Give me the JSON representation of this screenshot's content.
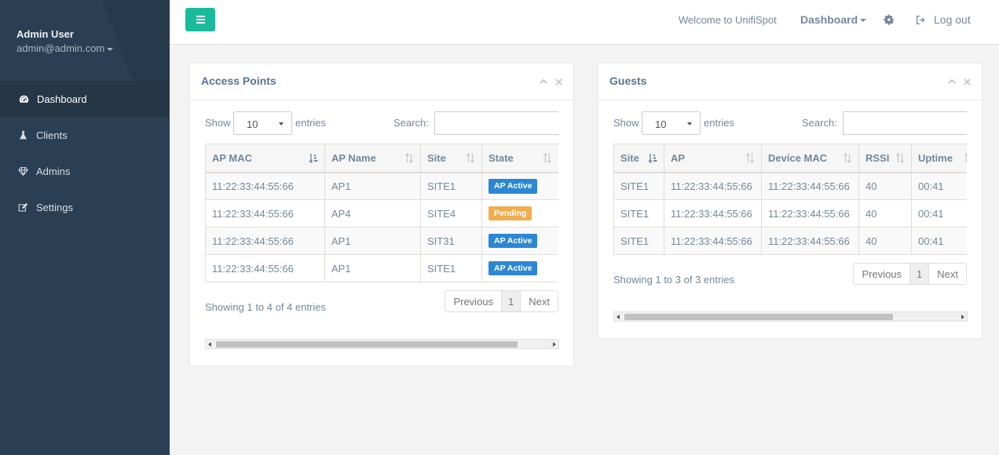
{
  "sidebar": {
    "user_name": "Admin User",
    "user_email": "admin@admin.com",
    "items": [
      {
        "label": "Dashboard",
        "icon": "dashboard-icon",
        "active": true
      },
      {
        "label": "Clients",
        "icon": "flask-icon",
        "active": false
      },
      {
        "label": "Admins",
        "icon": "diamond-icon",
        "active": false
      },
      {
        "label": "Settings",
        "icon": "edit-icon",
        "active": false
      }
    ]
  },
  "topbar": {
    "welcome": "Welcome to UnifiSpot",
    "dashboard_label": "Dashboard",
    "logout_label": "Log out"
  },
  "ap_panel": {
    "title": "Access Points",
    "show_label": "Show",
    "entries_label": "entries",
    "page_length": "10",
    "search_label": "Search:",
    "search_value": "",
    "columns": [
      "AP MAC",
      "AP Name",
      "Site",
      "State"
    ],
    "rows": [
      {
        "mac": "11:22:33:44:55:66",
        "name": "AP1",
        "site": "SITE1",
        "state": "AP Active",
        "state_type": "active"
      },
      {
        "mac": "11:22:33:44:55:66",
        "name": "AP4",
        "site": "SITE4",
        "state": "Pending",
        "state_type": "pending"
      },
      {
        "mac": "11:22:33:44:55:66",
        "name": "AP1",
        "site": "SIT31",
        "state": "AP Active",
        "state_type": "active"
      },
      {
        "mac": "11:22:33:44:55:66",
        "name": "AP1",
        "site": "SITE1",
        "state": "AP Active",
        "state_type": "active"
      }
    ],
    "info": "Showing 1 to 4 of 4 entries",
    "prev": "Previous",
    "page": "1",
    "next": "Next"
  },
  "guests_panel": {
    "title": "Guests",
    "show_label": "Show",
    "entries_label": "entries",
    "page_length": "10",
    "search_label": "Search:",
    "search_value": "",
    "columns": [
      "Site",
      "AP",
      "Device MAC",
      "RSSI",
      "Uptime"
    ],
    "rows": [
      {
        "site": "SITE1",
        "ap": "11:22:33:44:55:66",
        "device_mac": "11:22:33:44:55:66",
        "rssi": "40",
        "uptime": "00:41"
      },
      {
        "site": "SITE1",
        "ap": "11:22:33:44:55:66",
        "device_mac": "11:22:33:44:55:66",
        "rssi": "40",
        "uptime": "00:41"
      },
      {
        "site": "SITE1",
        "ap": "11:22:33:44:55:66",
        "device_mac": "11:22:33:44:55:66",
        "rssi": "40",
        "uptime": "00:41"
      }
    ],
    "info": "Showing 1 to 3 of 3 entries",
    "prev": "Previous",
    "page": "1",
    "next": "Next"
  },
  "colors": {
    "sidebar_bg": "#2a3f54",
    "accent": "#1abb9c",
    "badge_active": "#2c87d3",
    "badge_pending": "#f0ad4e"
  }
}
